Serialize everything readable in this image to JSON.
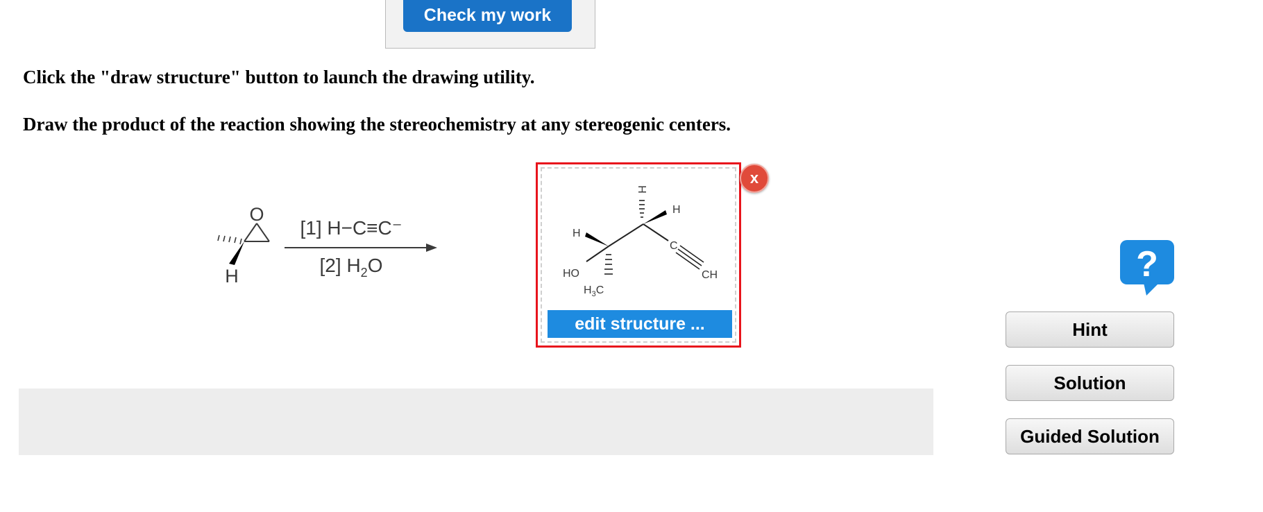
{
  "header": {
    "check_label": "Check my work"
  },
  "instructions": {
    "line1": "Click the \"draw structure\" button to launch the drawing utility.",
    "line2": "Draw the product of the reaction showing the stereochemistry at any stereogenic centers."
  },
  "reaction": {
    "reactant_atoms": {
      "oxygen": "O",
      "hydrogen": "H"
    },
    "reagent_step1": "[1] H−C≡C⁻",
    "reagent_step2_prefix": "[2] H",
    "reagent_step2_sub": "2",
    "reagent_step2_suffix": "O"
  },
  "answer": {
    "atom_h_top": "H",
    "atom_h_right": "H",
    "atom_h_left": "H",
    "atom_ho": "HO",
    "atom_c": "C",
    "atom_ch": "CH",
    "methyl_h": "H",
    "methyl_sub": "3",
    "methyl_c": "C",
    "edit_label": "edit structure ...",
    "close_label": "x"
  },
  "sidebar": {
    "help_icon": "question-icon",
    "hint_label": "Hint",
    "solution_label": "Solution",
    "guided_label": "Guided Solution"
  },
  "colors": {
    "primary_blue": "#1a73c7",
    "edit_blue": "#1e8be0",
    "answer_border": "#e8141c",
    "close_red": "#e04a3a",
    "panel_gray": "#ededed"
  }
}
